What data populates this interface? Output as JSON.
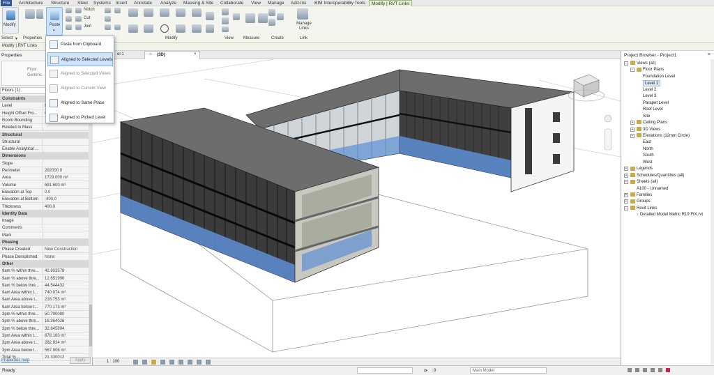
{
  "ribbon_tabs": [
    "File",
    "Architecture",
    "Structure",
    "Steel",
    "Systems",
    "Insert",
    "Annotate",
    "Analyze",
    "Massing & Site",
    "Collaborate",
    "View",
    "Manage",
    "Add-Ins",
    "BIM Interoperability Tools",
    "Modify | RVT Links"
  ],
  "ribbon": {
    "modify": "Modify",
    "paste": "Paste",
    "notch": "Notch",
    "cut": "Cut",
    "join": "Join",
    "select": "Select",
    "properties": "Properties",
    "manage_links": "Manage Links",
    "panels": [
      "Modify",
      "View",
      "Measure",
      "Create",
      "Link"
    ]
  },
  "options_bar": {
    "context": "Modify | RVT Links"
  },
  "paste_menu": [
    {
      "label": "Paste from Clipboard",
      "state": "normal"
    },
    {
      "label": "Aligned to Selected Levels",
      "state": "highlighted"
    },
    {
      "label": "Aligned to Selected Views",
      "state": "disabled"
    },
    {
      "label": "Aligned to Current View",
      "state": "disabled"
    },
    {
      "label": "Aligned to Same Place",
      "state": "normal"
    },
    {
      "label": "Aligned to Picked Level",
      "state": "normal"
    }
  ],
  "properties": {
    "title": "Properties",
    "type_name": "Floor",
    "type_sub": "Generic",
    "selector": "Floors (1)",
    "rows": [
      {
        "k": "Constraints",
        "v": "",
        "hdr": true
      },
      {
        "k": "Level",
        "v": "L"
      },
      {
        "k": "Height Offset Fro...",
        "v": "0"
      },
      {
        "k": "Room Bounding",
        "v": ""
      },
      {
        "k": "Related to Mass",
        "v": ""
      },
      {
        "k": "Structural",
        "v": "",
        "hdr": true
      },
      {
        "k": "Structural",
        "v": ""
      },
      {
        "k": "Enable Analytical ...",
        "v": ""
      },
      {
        "k": "Dimensions",
        "v": "",
        "hdr": true
      },
      {
        "k": "Slope",
        "v": ""
      },
      {
        "k": "Perimeter",
        "v": "292000.0"
      },
      {
        "k": "Area",
        "v": "1729.000 m²"
      },
      {
        "k": "Volume",
        "v": "691.600 m³"
      },
      {
        "k": "Elevation at Top",
        "v": "0.0"
      },
      {
        "k": "Elevation at Bottom",
        "v": "-400.0"
      },
      {
        "k": "Thickness",
        "v": "400.0"
      },
      {
        "k": "Identity Data",
        "v": "",
        "hdr": true
      },
      {
        "k": "Image",
        "v": ""
      },
      {
        "k": "Comments",
        "v": ""
      },
      {
        "k": "Mark",
        "v": ""
      },
      {
        "k": "Phasing",
        "v": "",
        "hdr": true
      },
      {
        "k": "Phase Created",
        "v": "New Construction"
      },
      {
        "k": "Phase Demolished",
        "v": "None"
      },
      {
        "k": "Other",
        "v": "",
        "hdr": true
      },
      {
        "k": "9am % within thre...",
        "v": "42.803578"
      },
      {
        "k": "9am % above thre...",
        "v": "12.651990"
      },
      {
        "k": "9am % below thre...",
        "v": "44.544432"
      },
      {
        "k": "9am Area within t...",
        "v": "740.074 m²"
      },
      {
        "k": "9am Area above t...",
        "v": "218.753 m²"
      },
      {
        "k": "9am Area below t...",
        "v": "770.173 m²"
      },
      {
        "k": "3pm % within thre...",
        "v": "50.790080"
      },
      {
        "k": "3pm % above thre...",
        "v": "16.364026"
      },
      {
        "k": "3pm % below thre...",
        "v": "32.845894"
      },
      {
        "k": "3pm Area within t...",
        "v": "878.160 m²"
      },
      {
        "k": "3pm Area above t...",
        "v": "282.934 m²"
      },
      {
        "k": "3pm Area below t...",
        "v": "567.906 m²"
      },
      {
        "k": "Total % ...",
        "v": "21.330012"
      }
    ],
    "help": "Properties help",
    "apply": "Apply"
  },
  "view": {
    "tab_label": "(3D)",
    "partial_tab": "el 1",
    "scale": "1 : 100"
  },
  "browser": {
    "title": "Project Browser - Project1",
    "items": [
      {
        "label": "Views (all)",
        "depth": 0,
        "tog": "−"
      },
      {
        "label": "Floor Plans",
        "depth": 1,
        "tog": "−"
      },
      {
        "label": "Foundation Level",
        "depth": 3
      },
      {
        "label": "Level 1",
        "depth": 3,
        "selected": true
      },
      {
        "label": "Level 2",
        "depth": 3
      },
      {
        "label": "Level 3",
        "depth": 3
      },
      {
        "label": "Parapet Level",
        "depth": 3
      },
      {
        "label": "Roof Level",
        "depth": 3
      },
      {
        "label": "Site",
        "depth": 3
      },
      {
        "label": "Ceiling Plans",
        "depth": 1,
        "tog": "+"
      },
      {
        "label": "3D Views",
        "depth": 1,
        "tog": "+"
      },
      {
        "label": "Elevations (12mm Circle)",
        "depth": 1,
        "tog": "−"
      },
      {
        "label": "East",
        "depth": 3
      },
      {
        "label": "North",
        "depth": 3
      },
      {
        "label": "South",
        "depth": 3
      },
      {
        "label": "West",
        "depth": 3
      },
      {
        "label": "Legends",
        "depth": 0,
        "tog": "+"
      },
      {
        "label": "Schedules/Quantities (all)",
        "depth": 0,
        "tog": "+"
      },
      {
        "label": "Sheets (all)",
        "depth": 0,
        "tog": "−"
      },
      {
        "label": "A100 - Unnamed",
        "depth": 2
      },
      {
        "label": "Families",
        "depth": 0,
        "tog": "+"
      },
      {
        "label": "Groups",
        "depth": 0,
        "tog": "+"
      },
      {
        "label": "Revit Links",
        "depth": 0,
        "tog": "−"
      },
      {
        "label": "Detailed Model Metric R19 FIX.rvt",
        "depth": 2,
        "link": true
      }
    ]
  },
  "status": {
    "text": "Ready",
    "model": "Main Model",
    "zero": ":0"
  }
}
